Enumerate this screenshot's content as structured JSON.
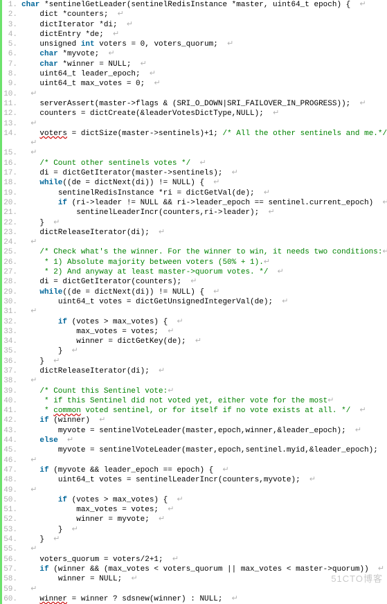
{
  "watermark": "51CTO博客",
  "eol": "↵",
  "lines": [
    {
      "n": 1,
      "ind": "",
      "tokens": [
        [
          "kw",
          "char"
        ],
        [
          "np",
          " *sentinelGetLeader(sentinelRedisInstance *master, uint64_t epoch) {  "
        ]
      ]
    },
    {
      "n": 2,
      "ind": "    ",
      "tokens": [
        [
          "np",
          "dict *counters;  "
        ]
      ]
    },
    {
      "n": 3,
      "ind": "    ",
      "tokens": [
        [
          "np",
          "dictIterator *di;  "
        ]
      ]
    },
    {
      "n": 4,
      "ind": "    ",
      "tokens": [
        [
          "np",
          "dictEntry *de;  "
        ]
      ]
    },
    {
      "n": 5,
      "ind": "    ",
      "tokens": [
        [
          "np",
          "unsigned "
        ],
        [
          "kw",
          "int"
        ],
        [
          "np",
          " voters = 0, voters_quorum;  "
        ]
      ]
    },
    {
      "n": 6,
      "ind": "    ",
      "tokens": [
        [
          "kw",
          "char"
        ],
        [
          "np",
          " *myvote;  "
        ]
      ]
    },
    {
      "n": 7,
      "ind": "    ",
      "tokens": [
        [
          "kw",
          "char"
        ],
        [
          "np",
          " *winner = NULL;  "
        ]
      ]
    },
    {
      "n": 8,
      "ind": "    ",
      "tokens": [
        [
          "np",
          "uint64_t leader_epoch;  "
        ]
      ]
    },
    {
      "n": 9,
      "ind": "    ",
      "tokens": [
        [
          "np",
          "uint64_t max_votes = 0;  "
        ]
      ]
    },
    {
      "n": 10,
      "ind": "",
      "tokens": [
        [
          "np",
          "  "
        ]
      ]
    },
    {
      "n": 11,
      "ind": "    ",
      "tokens": [
        [
          "np",
          "serverAssert(master->flags & (SRI_O_DOWN|SRI_FAILOVER_IN_PROGRESS));  "
        ]
      ]
    },
    {
      "n": 12,
      "ind": "    ",
      "tokens": [
        [
          "np",
          "counters = dictCreate(&leaderVotesDictType,NULL);  "
        ]
      ]
    },
    {
      "n": 13,
      "ind": "",
      "tokens": [
        [
          "np",
          "  "
        ]
      ]
    },
    {
      "n": 14,
      "ind": "    ",
      "tokens": [
        [
          "decor",
          "voters"
        ],
        [
          "np",
          " = dictSize(master->sentinels)+1; "
        ],
        [
          "cm",
          "/* All the other sentinels and me.*/"
        ]
      ]
    },
    {
      "n": "",
      "ind": "",
      "tokens": [
        [
          "np",
          "  "
        ]
      ]
    },
    {
      "n": 15,
      "ind": "",
      "tokens": [
        [
          "np",
          "  "
        ]
      ]
    },
    {
      "n": 16,
      "ind": "    ",
      "tokens": [
        [
          "cm",
          "/* Count other sentinels votes */"
        ],
        [
          "np",
          "  "
        ]
      ]
    },
    {
      "n": 17,
      "ind": "    ",
      "tokens": [
        [
          "np",
          "di = dictGetIterator(master->sentinels);  "
        ]
      ]
    },
    {
      "n": 18,
      "ind": "    ",
      "tokens": [
        [
          "kw",
          "while"
        ],
        [
          "np",
          "((de = dictNext(di)) != NULL) {  "
        ]
      ]
    },
    {
      "n": 19,
      "ind": "        ",
      "tokens": [
        [
          "np",
          "sentinelRedisInstance *ri = dictGetVal(de);  "
        ]
      ]
    },
    {
      "n": 20,
      "ind": "        ",
      "tokens": [
        [
          "kw",
          "if"
        ],
        [
          "np",
          " (ri->leader != NULL && ri->leader_epoch == sentinel.current_epoch)  "
        ]
      ]
    },
    {
      "n": 21,
      "ind": "            ",
      "tokens": [
        [
          "np",
          "sentinelLeaderIncr(counters,ri->leader);  "
        ]
      ]
    },
    {
      "n": 22,
      "ind": "    ",
      "tokens": [
        [
          "np",
          "}  "
        ]
      ]
    },
    {
      "n": 23,
      "ind": "    ",
      "tokens": [
        [
          "np",
          "dictReleaseIterator(di);  "
        ]
      ]
    },
    {
      "n": 24,
      "ind": "",
      "tokens": [
        [
          "np",
          "  "
        ]
      ]
    },
    {
      "n": 25,
      "ind": "    ",
      "tokens": [
        [
          "cm",
          "/* Check what's the winner. For the winner to win, it needs two conditions:"
        ]
      ]
    },
    {
      "n": 26,
      "ind": "",
      "tokens": [
        [
          "cm",
          "     * 1) Absolute majority between voters (50% + 1)."
        ]
      ]
    },
    {
      "n": 27,
      "ind": "",
      "tokens": [
        [
          "cm",
          "     * 2) And anyway at least master->quorum votes. */"
        ],
        [
          "np",
          "  "
        ]
      ]
    },
    {
      "n": 28,
      "ind": "    ",
      "tokens": [
        [
          "np",
          "di = dictGetIterator(counters);  "
        ]
      ]
    },
    {
      "n": 29,
      "ind": "    ",
      "tokens": [
        [
          "kw",
          "while"
        ],
        [
          "np",
          "((de = dictNext(di)) != NULL) {  "
        ]
      ]
    },
    {
      "n": 30,
      "ind": "        ",
      "tokens": [
        [
          "np",
          "uint64_t votes = dictGetUnsignedIntegerVal(de);  "
        ]
      ]
    },
    {
      "n": 31,
      "ind": "",
      "tokens": [
        [
          "np",
          "  "
        ]
      ]
    },
    {
      "n": 32,
      "ind": "        ",
      "tokens": [
        [
          "kw",
          "if"
        ],
        [
          "np",
          " (votes > max_votes) {  "
        ]
      ]
    },
    {
      "n": 33,
      "ind": "            ",
      "tokens": [
        [
          "np",
          "max_votes = votes;  "
        ]
      ]
    },
    {
      "n": 34,
      "ind": "            ",
      "tokens": [
        [
          "np",
          "winner = dictGetKey(de);  "
        ]
      ]
    },
    {
      "n": 35,
      "ind": "        ",
      "tokens": [
        [
          "np",
          "}  "
        ]
      ]
    },
    {
      "n": 36,
      "ind": "    ",
      "tokens": [
        [
          "np",
          "}  "
        ]
      ]
    },
    {
      "n": 37,
      "ind": "    ",
      "tokens": [
        [
          "np",
          "dictReleaseIterator(di);  "
        ]
      ]
    },
    {
      "n": 38,
      "ind": "",
      "tokens": [
        [
          "np",
          "  "
        ]
      ]
    },
    {
      "n": 39,
      "ind": "    ",
      "tokens": [
        [
          "cm",
          "/* Count this Sentinel vote:"
        ]
      ]
    },
    {
      "n": 40,
      "ind": "",
      "tokens": [
        [
          "cm",
          "     * if this Sentinel did not voted yet, either vote for the most"
        ]
      ]
    },
    {
      "n": 41,
      "ind": "",
      "tokens": [
        [
          "cm",
          "     * "
        ],
        [
          "cm decor",
          "common"
        ],
        [
          "cm",
          " voted sentinel, or for itself if no vote exists at all. */"
        ],
        [
          "np",
          "  "
        ]
      ]
    },
    {
      "n": 42,
      "ind": "    ",
      "tokens": [
        [
          "kw",
          "if"
        ],
        [
          "np",
          " (winner)  "
        ]
      ]
    },
    {
      "n": 43,
      "ind": "        ",
      "tokens": [
        [
          "np",
          "myvote = sentinelVoteLeader(master,epoch,winner,&leader_epoch);  "
        ]
      ]
    },
    {
      "n": 44,
      "ind": "    ",
      "tokens": [
        [
          "kw",
          "else"
        ],
        [
          "np",
          "  "
        ]
      ]
    },
    {
      "n": 45,
      "ind": "        ",
      "tokens": [
        [
          "np",
          "myvote = sentinelVoteLeader(master,epoch,sentinel.myid,&leader_epoch);  "
        ]
      ]
    },
    {
      "n": 46,
      "ind": "",
      "tokens": [
        [
          "np",
          "  "
        ]
      ]
    },
    {
      "n": 47,
      "ind": "    ",
      "tokens": [
        [
          "kw",
          "if"
        ],
        [
          "np",
          " (myvote && leader_epoch == epoch) {  "
        ]
      ]
    },
    {
      "n": 48,
      "ind": "        ",
      "tokens": [
        [
          "np",
          "uint64_t votes = sentinelLeaderIncr(counters,myvote);  "
        ]
      ]
    },
    {
      "n": 49,
      "ind": "",
      "tokens": [
        [
          "np",
          "  "
        ]
      ]
    },
    {
      "n": 50,
      "ind": "        ",
      "tokens": [
        [
          "kw",
          "if"
        ],
        [
          "np",
          " (votes > max_votes) {  "
        ]
      ]
    },
    {
      "n": 51,
      "ind": "            ",
      "tokens": [
        [
          "np",
          "max_votes = votes;  "
        ]
      ]
    },
    {
      "n": 52,
      "ind": "            ",
      "tokens": [
        [
          "np",
          "winner = myvote;  "
        ]
      ]
    },
    {
      "n": 53,
      "ind": "        ",
      "tokens": [
        [
          "np",
          "}  "
        ]
      ]
    },
    {
      "n": 54,
      "ind": "    ",
      "tokens": [
        [
          "np",
          "}  "
        ]
      ]
    },
    {
      "n": 55,
      "ind": "",
      "tokens": [
        [
          "np",
          "  "
        ]
      ]
    },
    {
      "n": 56,
      "ind": "    ",
      "tokens": [
        [
          "np",
          "voters_quorum = voters/2+1;  "
        ]
      ]
    },
    {
      "n": 57,
      "ind": "    ",
      "tokens": [
        [
          "kw",
          "if"
        ],
        [
          "np",
          " (winner && (max_votes < voters_quorum || max_votes < master->quorum))  "
        ]
      ]
    },
    {
      "n": 58,
      "ind": "        ",
      "tokens": [
        [
          "np",
          "winner = NULL;  "
        ]
      ]
    },
    {
      "n": 59,
      "ind": "",
      "tokens": [
        [
          "np",
          "  "
        ]
      ]
    },
    {
      "n": 60,
      "ind": "    ",
      "tokens": [
        [
          "decor",
          "winner"
        ],
        [
          "np",
          " = winner ? sdsnew(winner) : NULL;  "
        ]
      ]
    }
  ]
}
